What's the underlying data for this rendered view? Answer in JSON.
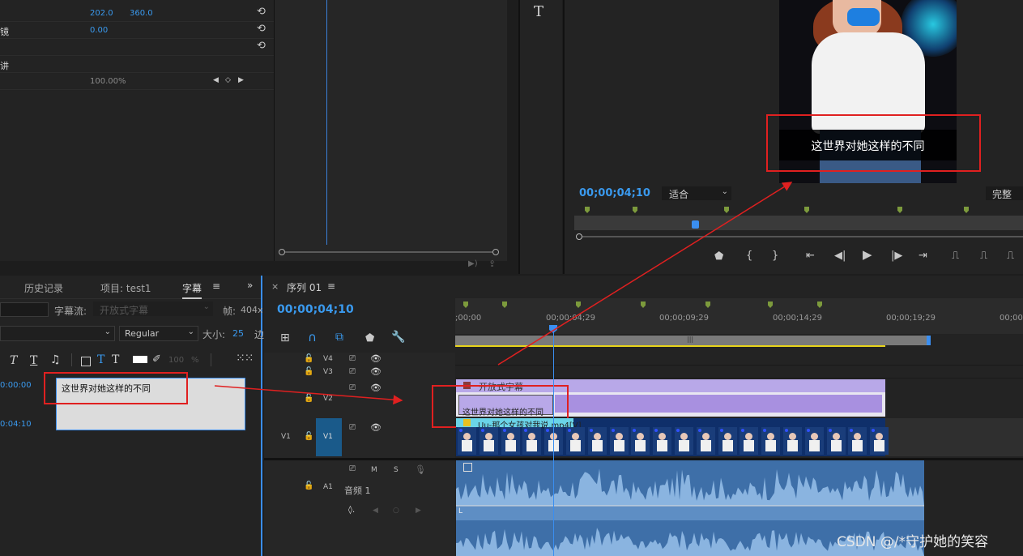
{
  "effect_controls": {
    "rows": [
      {
        "label": "",
        "v1": "202.0",
        "v2": "360.0"
      },
      {
        "label": "镜",
        "v1": "0.00",
        "v2": ""
      },
      {
        "label": "",
        "v1": "",
        "v2": ""
      },
      {
        "label": "讲",
        "v1": "",
        "v2": ""
      },
      {
        "label": "",
        "v1": "100.00%",
        "v2": ""
      }
    ]
  },
  "program_monitor": {
    "caption": "这世界对她这样的不同",
    "timecode": "00;00;04;10",
    "fit_label": "适合",
    "quality_label": "完整"
  },
  "captions_panel": {
    "tabs": [
      "历史记录",
      "项目: test1",
      "字幕"
    ],
    "stream_label": "字幕流:",
    "stream_value": "开放式字幕",
    "frame_label": "帧:",
    "frame_value": "404x",
    "font_style": "Regular",
    "size_label": "大小:",
    "size_value": "25",
    "cut_label": "边",
    "opacity_value": "100",
    "opacity_unit": "%",
    "entry": {
      "in_time": "0:00:00",
      "out_time": "0:04:10",
      "text": "这世界对她这样的不同"
    }
  },
  "timeline": {
    "sequence_name": "序列 01",
    "timecode": "00;00;04;10",
    "ruler": [
      ";00;00",
      "00;00;04;29",
      "00;00;09;29",
      "00;00;14;29",
      "00;00;19;29",
      "00;00;"
    ],
    "tracks": {
      "v4": "V4",
      "v3": "V3",
      "v2": "V2",
      "v1_src": "V1",
      "v1": "V1",
      "a1_src": "A1",
      "audio_name": "音频 1",
      "m": "M",
      "s": "S"
    },
    "clips": {
      "caption_track_label": "开放式字幕",
      "caption_clip_text": "这世界对她这样的不同",
      "video_clip_label": "Uu-那个女孩对我说.mp4[V]",
      "audio_channel": "L"
    }
  },
  "watermark": "CSDN @/*守护她的笑容"
}
